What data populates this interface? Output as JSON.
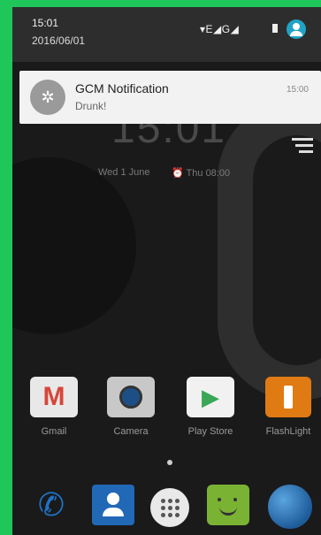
{
  "status_bar": {
    "time": "15:01",
    "date": "2016/06/01",
    "indicators": "▾E◢G◢"
  },
  "notification": {
    "app_title": "GCM Notification",
    "message": "Drunk!",
    "time": "15:00",
    "icon": "gear-icon"
  },
  "lock_screen": {
    "clock": "15:01",
    "date": "Wed 1 June",
    "alarm": "⏰ Thu 08:00"
  },
  "apps": [
    {
      "label": "Gmail",
      "icon": "gmail-icon"
    },
    {
      "label": "Camera",
      "icon": "camera-icon"
    },
    {
      "label": "Play Store",
      "icon": "play-store-icon"
    },
    {
      "label": "FlashLight",
      "icon": "flashlight-icon"
    }
  ],
  "dock": [
    "phone-icon",
    "contacts-icon",
    "app-drawer-icon",
    "messaging-icon",
    "browser-icon"
  ],
  "colors": {
    "frame_border": "#1fc75a",
    "status_bar": "#2d2d2d",
    "notification_bg": "#f2f2f2",
    "accent": "#21a3c7"
  }
}
